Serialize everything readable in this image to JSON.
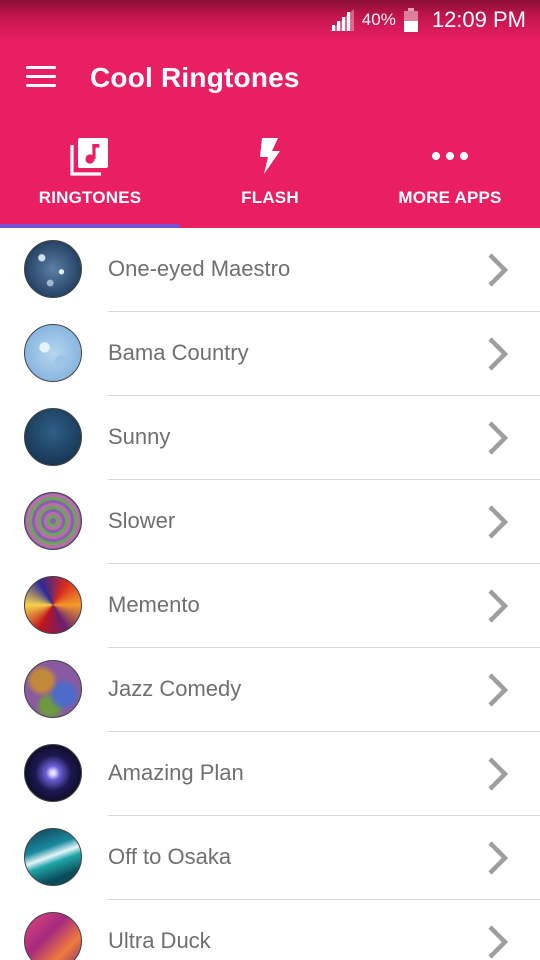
{
  "status": {
    "battery_pct": "40%",
    "time": "12:09 PM",
    "icons": [
      "signal-icon",
      "battery-icon"
    ]
  },
  "app": {
    "title": "Cool Ringtones",
    "menu_icon": "hamburger-menu-icon"
  },
  "tabs": [
    {
      "label": "RINGTONES",
      "icon": "music-library-icon",
      "selected": true
    },
    {
      "label": "FLASH",
      "icon": "flash-icon",
      "selected": false
    },
    {
      "label": "MORE APPS",
      "icon": "more-horizontal-icon",
      "selected": false
    }
  ],
  "ringtones": [
    {
      "name": "One-eyed Maestro"
    },
    {
      "name": "Bama Country"
    },
    {
      "name": "Sunny"
    },
    {
      "name": "Slower"
    },
    {
      "name": "Memento"
    },
    {
      "name": "Jazz Comedy"
    },
    {
      "name": "Amazing Plan"
    },
    {
      "name": "Off to Osaka"
    },
    {
      "name": "Ultra Duck"
    }
  ],
  "colors": {
    "primary": "#e91e63",
    "tab_indicator": "#7b50d9",
    "list_text": "#6f6f6f",
    "chevron": "#9e9e9e"
  }
}
